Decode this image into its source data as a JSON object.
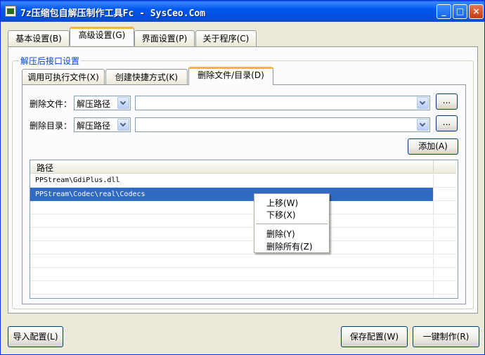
{
  "window": {
    "title": "7z压缩包自解压制作工具Fc - SysCeo.Com",
    "min": "_",
    "max": "□",
    "close": "×"
  },
  "main_tabs": [
    {
      "label": "基本设置(B)"
    },
    {
      "label": "高级设置(G)"
    },
    {
      "label": "界面设置(P)"
    },
    {
      "label": "关于程序(C)"
    }
  ],
  "group": {
    "label": "解压后接口设置"
  },
  "sub_tabs": [
    {
      "label": "调用可执行文件(X)"
    },
    {
      "label": "创建快捷方式(K)"
    },
    {
      "label": "删除文件/目录(D)"
    }
  ],
  "delete_file": {
    "label": "删除文件：",
    "path_type": "解压路径",
    "value": "",
    "browse": "..."
  },
  "delete_dir": {
    "label": "删除目录：",
    "path_type": "解压路径",
    "value": "",
    "browse": "..."
  },
  "add_button": "添加(A)",
  "list": {
    "column": "路径",
    "rows": [
      {
        "path": "PPStream\\GdiPlus.dll"
      },
      {
        "path": "PPStream\\Codec\\real\\Codecs"
      }
    ]
  },
  "context_menu": {
    "move_up": "上移(W)",
    "move_down": "下移(X)",
    "delete": "删除(Y)",
    "delete_all": "删除所有(Z)"
  },
  "buttons": {
    "import": "导入配置(L)",
    "save": "保存配置(W)",
    "build": "一键制作(R)"
  },
  "colors": {
    "title_bar": "#0058ee",
    "tab_highlight": "#f8b33f",
    "selection": "#316ac5",
    "group_label": "#0046d5"
  }
}
